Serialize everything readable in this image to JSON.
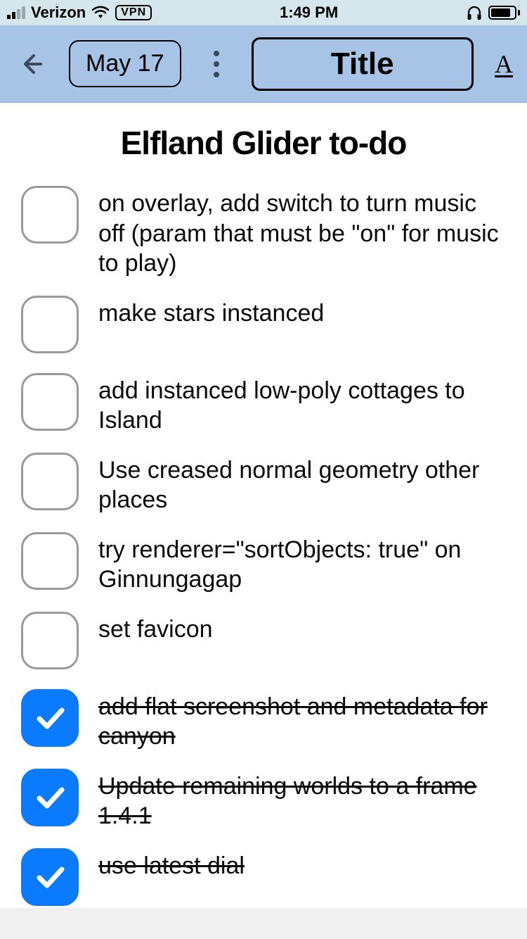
{
  "status": {
    "carrier": "Verizon",
    "vpn": "VPN",
    "time": "1:49 PM"
  },
  "toolbar": {
    "date": "May 17",
    "title_button": "Title",
    "format_button": "A"
  },
  "page": {
    "title": "Elfland Glider to-do"
  },
  "todos": [
    {
      "checked": false,
      "text": "on overlay, add switch to turn music off (param that must be \"on\" for music to play)"
    },
    {
      "checked": false,
      "text": "make stars instanced"
    },
    {
      "checked": false,
      "text": "add instanced low-poly cottages to Island"
    },
    {
      "checked": false,
      "text": "Use creased normal geometry other places"
    },
    {
      "checked": false,
      "text": "try renderer=\"sortObjects: true\" on Ginnungagap"
    },
    {
      "checked": false,
      "text": "set favicon"
    },
    {
      "checked": true,
      "text": "add flat screenshot and metadata for canyon"
    },
    {
      "checked": true,
      "text": "Update remaining worlds to a frame 1.4.1"
    },
    {
      "checked": true,
      "text": "use latest dial"
    }
  ]
}
